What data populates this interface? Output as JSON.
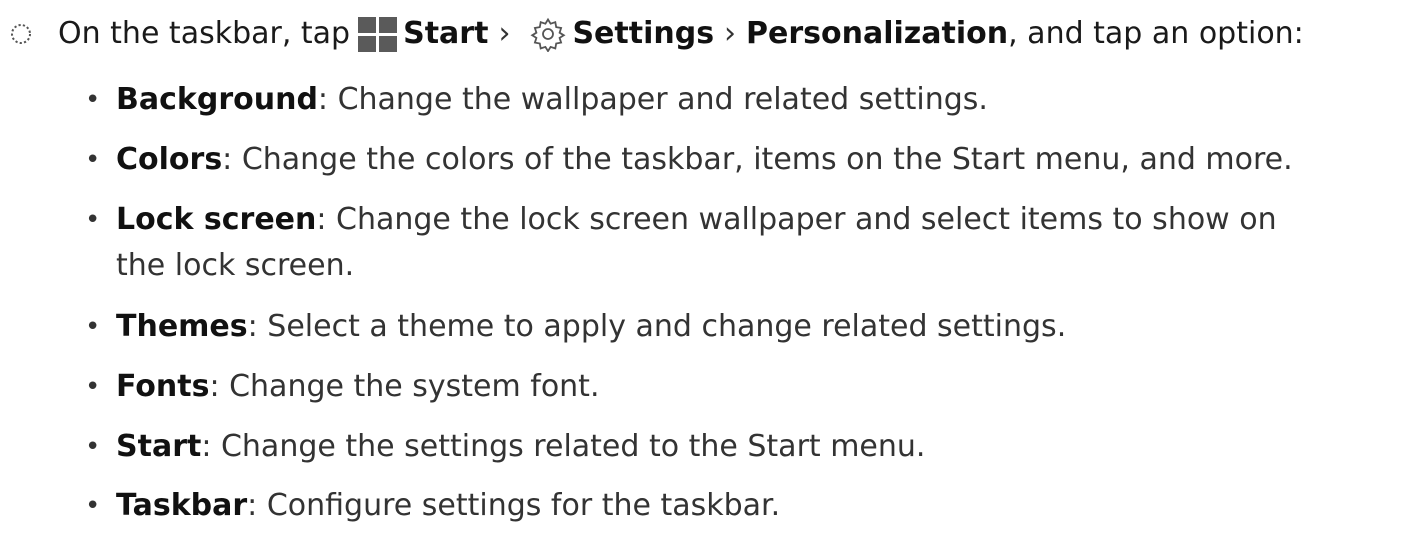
{
  "step": {
    "prefix": "On the taskbar, tap",
    "start_label": "Start",
    "separator": "›",
    "settings_label": "Settings",
    "personalization_label": "Personalization",
    "suffix": ", and tap an option:"
  },
  "options": [
    {
      "name": "Background",
      "description": ": Change the wallpaper and related settings."
    },
    {
      "name": "Colors",
      "description": ": Change the colors of the taskbar, items on the Start menu, and more."
    },
    {
      "name": "Lock screen",
      "description": ": Change the lock screen wallpaper and select items to show on",
      "description_line2": "the lock screen."
    },
    {
      "name": "Themes",
      "description": ": Select a theme to apply and change related settings."
    },
    {
      "name": "Fonts",
      "description": ": Change the system font."
    },
    {
      "name": "Start",
      "description": ": Change the settings related to the Start menu."
    },
    {
      "name": "Taskbar",
      "description": ": Configure settings for the taskbar."
    }
  ],
  "icons": {
    "step_marker": "dotted-circle-icon",
    "start": "windows-start-icon",
    "settings": "gear-icon"
  },
  "colors": {
    "text": "#1a1a1a",
    "icon_gray": "#5a5a5a"
  }
}
